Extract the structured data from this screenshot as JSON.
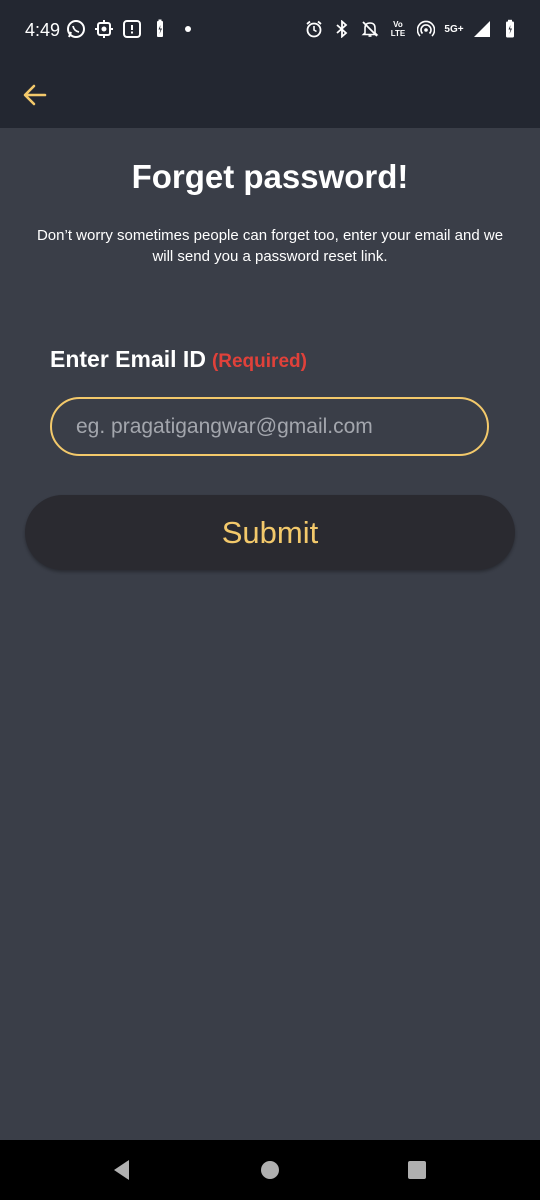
{
  "status_bar": {
    "time": "4:49",
    "left_icons": [
      "whatsapp-icon",
      "settings-chip-icon",
      "notification-box-icon",
      "battery-small-icon",
      "dot-icon"
    ],
    "right_icons": [
      "alarm-icon",
      "bluetooth-icon",
      "bell-off-icon",
      "volte-icon",
      "hotspot-icon",
      "5g-icon",
      "signal-icon",
      "battery-icon"
    ],
    "volte_label_top": "Vo",
    "volte_label_bottom": "LTE",
    "network_label": "5G+"
  },
  "app_bar": {
    "back_icon": "arrow-left-icon",
    "accent_color": "#f3c96b"
  },
  "page": {
    "title": "Forget password!",
    "description": "Don’t worry sometimes people can forget too, enter your email and we will send you a password reset link.",
    "email_label": "Enter Email ID",
    "email_required": "(Required)",
    "email_value": "",
    "email_placeholder": "eg. pragatigangwar@gmail.com",
    "submit_label": "Submit"
  },
  "nav_bar": {
    "back_icon": "triangle-back-icon",
    "home_icon": "circle-home-icon",
    "recents_icon": "square-recents-icon"
  },
  "colors": {
    "background": "#3a3e48",
    "bars": "#232731",
    "accent": "#f3c96b",
    "required": "#e0413a",
    "button_bg": "#2a2a30"
  }
}
